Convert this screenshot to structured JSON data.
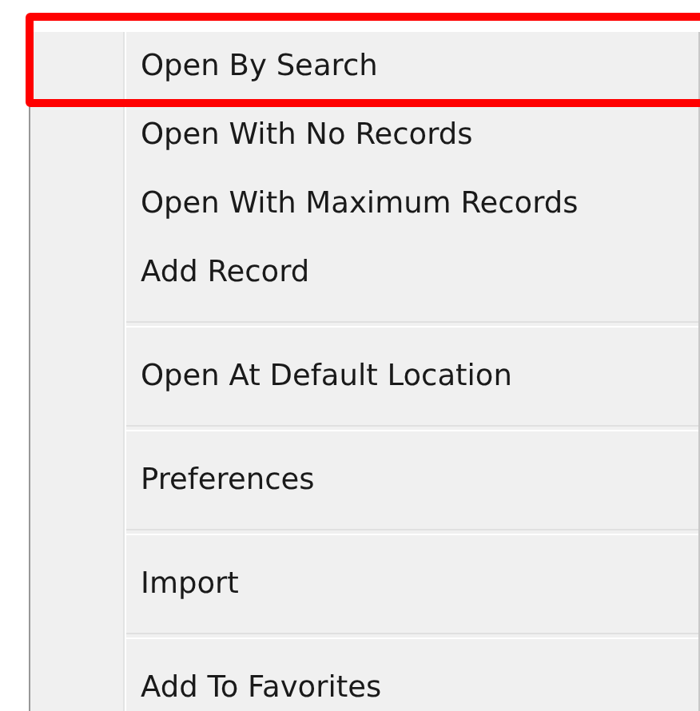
{
  "menu": {
    "groups": [
      {
        "items": [
          {
            "label": "Open By Search",
            "highlighted": true
          },
          {
            "label": "Open With No Records",
            "highlighted": false
          },
          {
            "label": "Open With Maximum Records",
            "highlighted": false
          },
          {
            "label": "Add Record",
            "highlighted": false
          }
        ]
      },
      {
        "items": [
          {
            "label": "Open At Default Location",
            "highlighted": false
          }
        ]
      },
      {
        "items": [
          {
            "label": "Preferences",
            "highlighted": false
          }
        ]
      },
      {
        "items": [
          {
            "label": "Import",
            "highlighted": false
          }
        ]
      },
      {
        "items": [
          {
            "label": "Add To Favorites",
            "highlighted": false
          }
        ]
      }
    ]
  }
}
